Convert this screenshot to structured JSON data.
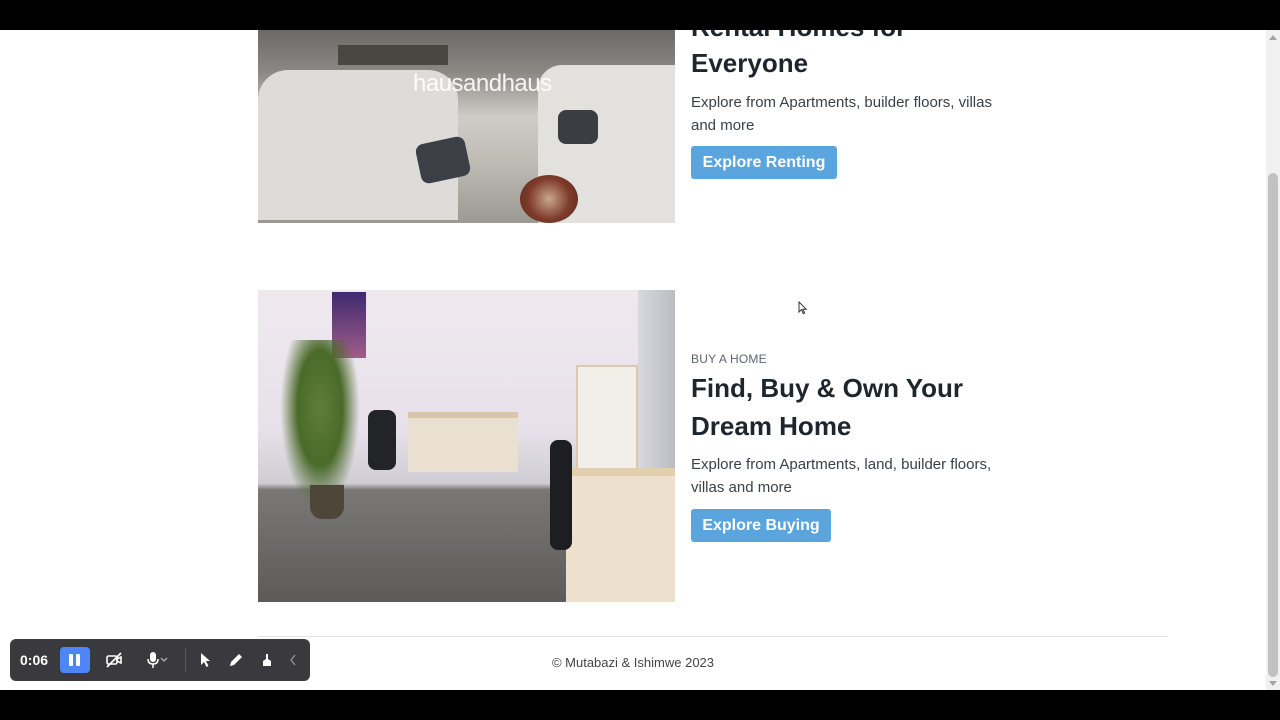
{
  "rent": {
    "heading_partial": "Rental Homes for",
    "heading_line2": "Everyone",
    "description": "Explore from Apartments, builder floors, villas and more",
    "button_label": "Explore Renting",
    "image_watermark": "hausandhaus"
  },
  "buy": {
    "eyebrow": "BUY A HOME",
    "heading": "Find, Buy & Own Your Dream Home",
    "description": "Explore from Apartments, land, builder floors, villas and more",
    "button_label": "Explore Buying"
  },
  "footer": {
    "copyright": "© Mutabazi & Ishimwe 2023"
  },
  "recorder": {
    "time": "0:06",
    "icons": [
      "pause-icon",
      "camera-off-icon",
      "microphone-icon",
      "chevron-down-icon",
      "pointer-icon",
      "pen-icon",
      "eraser-icon",
      "collapse-icon"
    ]
  },
  "colors": {
    "button": "#5ba5df",
    "recorder_primary": "#4f86f7",
    "recorder_bg": "#3a3a3e"
  }
}
